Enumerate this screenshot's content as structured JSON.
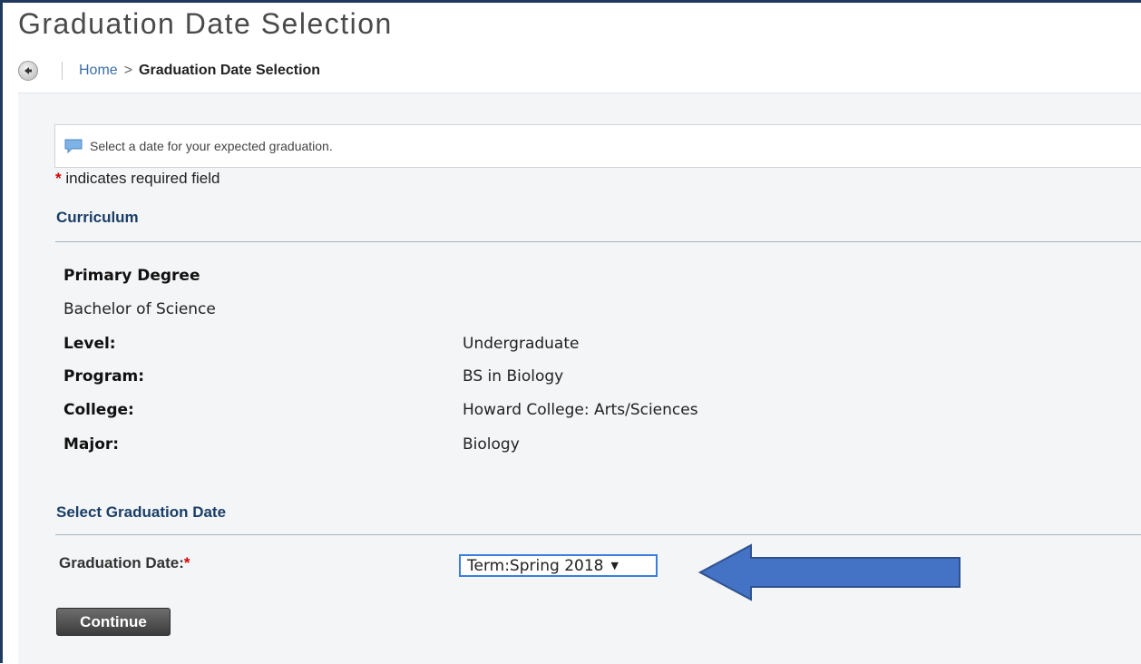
{
  "page": {
    "title": "Graduation Date Selection"
  },
  "breadcrumb": {
    "home": "Home",
    "separator": ">",
    "current": "Graduation Date Selection"
  },
  "info_message": "Select a date for your expected graduation.",
  "required_note": {
    "star": "*",
    "text": "indicates required field"
  },
  "curriculum": {
    "heading": "Curriculum",
    "degree_label": "Primary Degree",
    "degree_value": "Bachelor of Science",
    "fields": [
      {
        "label": "Level:",
        "value": "Undergraduate"
      },
      {
        "label": "Program:",
        "value": "BS in Biology"
      },
      {
        "label": "College:",
        "value": "Howard College: Arts/Sciences"
      },
      {
        "label": "Major:",
        "value": "Biology"
      }
    ]
  },
  "graduation": {
    "heading": "Select Graduation Date",
    "label": "Graduation Date:",
    "required_star": "*",
    "selected": "Term:Spring 2018",
    "caret": "▼"
  },
  "buttons": {
    "continue": "Continue"
  },
  "colors": {
    "accent": "#1b3e66",
    "link": "#3a6ea8",
    "required": "#d60000",
    "arrow": "#4472c4"
  },
  "icons": {
    "back": "back-arrow-icon",
    "info": "speech-bubble-icon",
    "annotation": "left-arrow-icon"
  }
}
